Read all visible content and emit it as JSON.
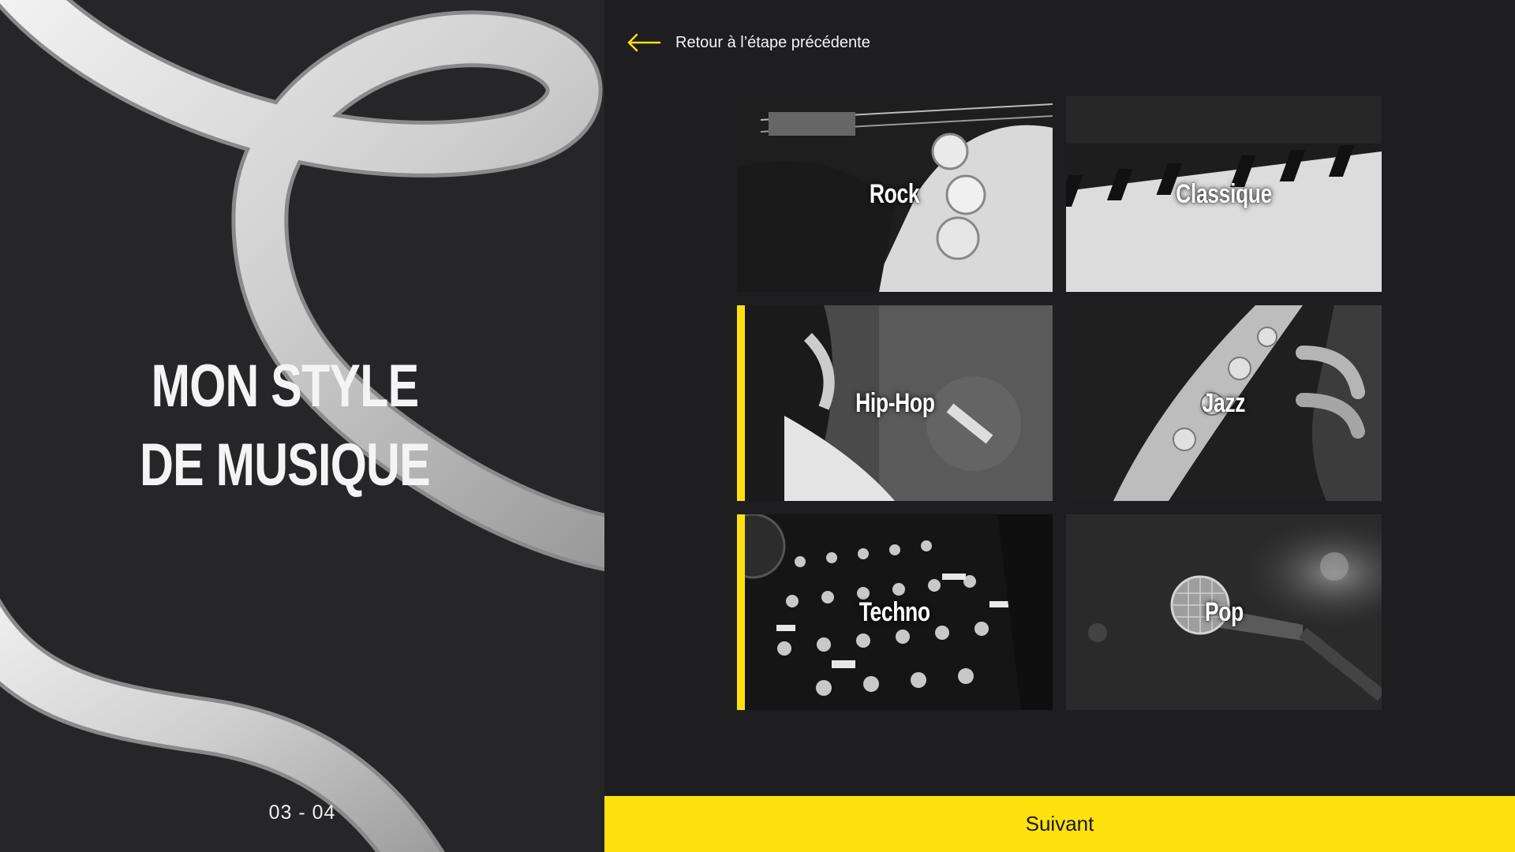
{
  "sidebar": {
    "title_line1": "MON STYLE",
    "title_line2": "DE MUSIQUE",
    "step": "03 - 04"
  },
  "nav": {
    "back_label": "Retour à l’étape précédente",
    "back_icon": "arrow-left-icon"
  },
  "genres": [
    {
      "label": "Rock",
      "selected": false,
      "image": "electric-guitar-closeup"
    },
    {
      "label": "Classique",
      "selected": false,
      "image": "piano-keys"
    },
    {
      "label": "Hip-Hop",
      "selected": true,
      "image": "guitarist-hands"
    },
    {
      "label": "Jazz",
      "selected": false,
      "image": "saxophone"
    },
    {
      "label": "Techno",
      "selected": true,
      "image": "dj-mixer"
    },
    {
      "label": "Pop",
      "selected": false,
      "image": "microphone"
    }
  ],
  "actions": {
    "next_label": "Suivant"
  },
  "colors": {
    "accent": "#ffe10f",
    "left_panel": "#262527",
    "right_panel": "#1e1d1f"
  }
}
